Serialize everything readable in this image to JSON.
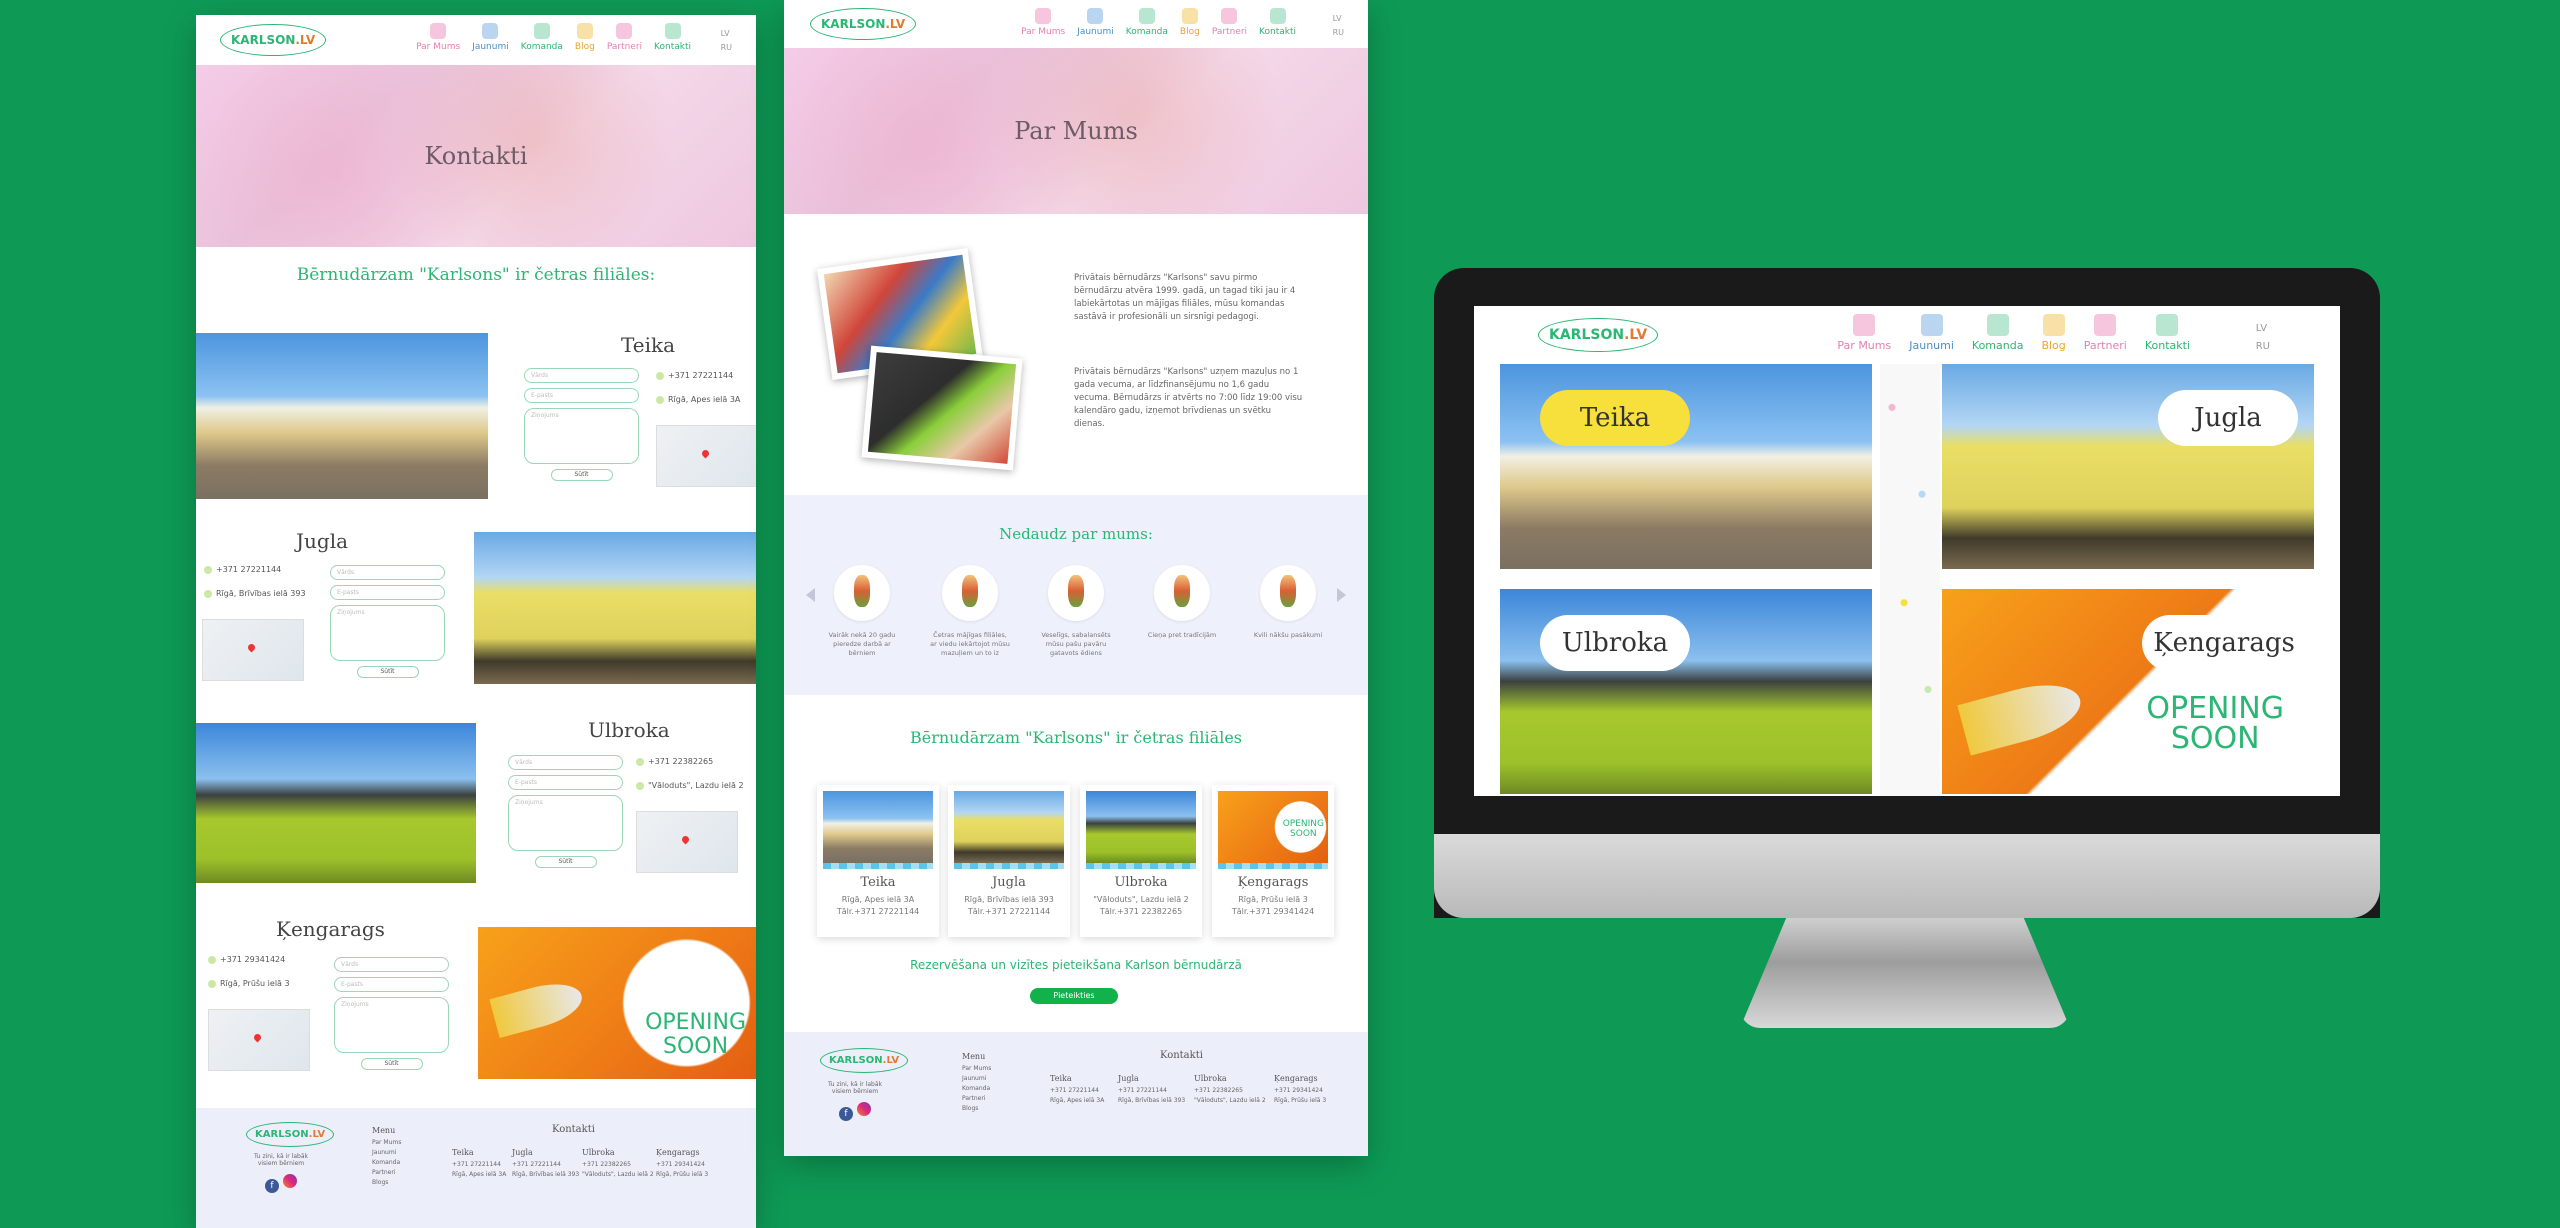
{
  "nav": {
    "items": [
      {
        "label": "Par Mums",
        "color": "#e47fb0"
      },
      {
        "label": "Jaunumi",
        "color": "#4a90c8"
      },
      {
        "label": "Komanda",
        "color": "#2bb673"
      },
      {
        "label": "Blog",
        "color": "#e8a62a"
      },
      {
        "label": "Partneri",
        "color": "#e47fb0"
      },
      {
        "label": "Kontakti",
        "color": "#2bb673"
      }
    ],
    "lang_lv": "LV",
    "lang_ru": "RU",
    "logo": "KARLSON",
    "logo_suffix": ".LV"
  },
  "contacts_page": {
    "hero_title": "Kontakti",
    "section_title": "Bērnudārzam \"Karlsons\" ir četras filiāles:",
    "branches": [
      {
        "name": "Teika",
        "phone": "+371 27221144",
        "address": "Rīgā, Apes ielā 3A"
      },
      {
        "name": "Jugla",
        "phone": "+371 27221144",
        "address": "Rīgā, Brīvības ielā 393"
      },
      {
        "name": "Ulbroka",
        "phone": "+371 22382265",
        "address": "\"Vāloduts\", Lazdu ielā 2"
      },
      {
        "name": "Ķengarags",
        "phone": "+371 29341424",
        "address": "Rīgā, Prūšu ielā 3"
      }
    ],
    "form": {
      "name_ph": "Vārds",
      "email_ph": "E-pasts",
      "msg_ph": "Ziņojums",
      "submit": "Sūtīt"
    },
    "opening_soon": [
      "OPENING",
      "SOON"
    ]
  },
  "about_page": {
    "hero_title": "Par Mums",
    "text1": "Privātais bērnudārzs \"Karlsons\" savu pirmo bērnudārzu atvēra 1999. gadā, un tagad tiki jau ir 4 labiekārtotas un mājīgas filiāles, mūsu komandas sastāvā ir profesionāli un sirsnīgi pedagogi.",
    "text2": "Privātais bērnudārzs \"Karlsons\" uzņem mazuļus no 1 gada vecuma, ar līdzfinansējumu no 1,6 gadu vecuma. Bērnudārzs ir atvērts no 7:00 līdz 19:00 visu kalendāro gadu, izņemot brīvdienas un svētku dienas.",
    "recent_title": "Nedaudz par mums:",
    "recent_items": [
      "Vairāk nekā 20 gadu pieredze darbā ar bērniem",
      "Četras mājīgas filiāles, ar viedu iekārtojot mūsu mazuļiem un to iz",
      "Veselīgs, sabalansēts mūsu pašu pavāru gatavots ēdiens",
      "Cieņa pret tradīcijām",
      "Kvili nākšu pasākumi"
    ],
    "section_title": "Bērnudārzam \"Karlsons\" ir četras filiāles",
    "cards": [
      {
        "name": "Teika",
        "addr": "Rīgā, Apes ielā 3A",
        "tel": "Tālr.+371 27221144"
      },
      {
        "name": "Jugla",
        "addr": "Rīgā, Brīvības ielā 393",
        "tel": "Tālr.+371 27221144"
      },
      {
        "name": "Ulbroka",
        "addr": "\"Vāloduts\", Lazdu ielā 2",
        "tel": "Tālr.+371 22382265"
      },
      {
        "name": "Ķengarags",
        "addr": "Rīgā, Prūšu ielā 3",
        "tel": "Tālr.+371 29341424"
      }
    ],
    "reserve_text": "Rezervēšana un vizītes pieteikšana Karlson bērnudārzā",
    "reserve_button": "Pieteikties",
    "card_opening": [
      "OPENING",
      "SOON"
    ]
  },
  "footer": {
    "tagline": "Tu zini, kā ir labāk visiem bērniem",
    "menu_title": "Menu",
    "menu_items": [
      "Par Mums",
      "Jaunumi",
      "Komanda",
      "Partneri",
      "Blogs"
    ],
    "contacts_title": "Kontakti",
    "cols": [
      "Teika",
      "Jugla",
      "Ulbroka",
      "Ķengarags"
    ]
  },
  "monitor": {
    "tiles": [
      "Teika",
      "Jugla",
      "Ulbroka",
      "Ķengarags"
    ],
    "opening_soon": [
      "OPENING",
      "SOON"
    ]
  }
}
